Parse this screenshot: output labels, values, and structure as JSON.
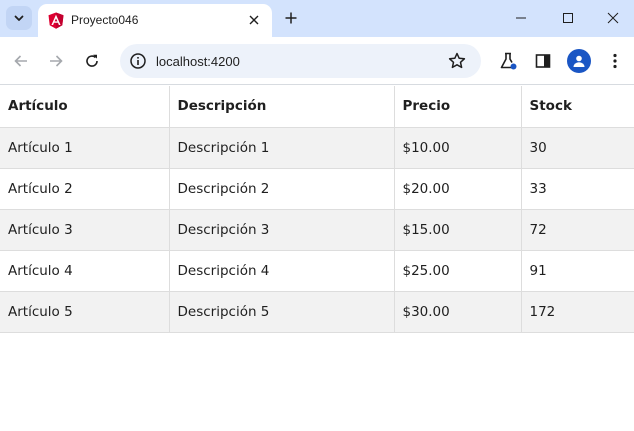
{
  "browser": {
    "tab_title": "Proyecto046",
    "url": "localhost:4200",
    "favicon_icon": "angular-logo-icon",
    "accent_color": "#d3e3fd"
  },
  "table": {
    "headers": [
      "Artículo",
      "Descripción",
      "Precio",
      "Stock"
    ],
    "rows": [
      [
        "Artículo 1",
        "Descripción 1",
        "$10.00",
        "30"
      ],
      [
        "Artículo 2",
        "Descripción 2",
        "$20.00",
        "33"
      ],
      [
        "Artículo 3",
        "Descripción 3",
        "$15.00",
        "72"
      ],
      [
        "Artículo 4",
        "Descripción 4",
        "$25.00",
        "91"
      ],
      [
        "Artículo 5",
        "Descripción 5",
        "$30.00",
        "172"
      ]
    ]
  }
}
